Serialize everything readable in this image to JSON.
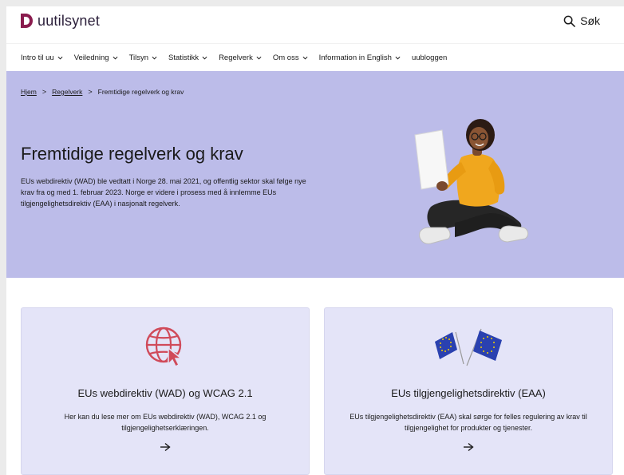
{
  "header": {
    "logo_text": "uutilsynet",
    "search_label": "Søk"
  },
  "nav": {
    "items": [
      {
        "label": "Intro til uu",
        "dropdown": true
      },
      {
        "label": "Veiledning",
        "dropdown": true
      },
      {
        "label": "Tilsyn",
        "dropdown": true
      },
      {
        "label": "Statistikk",
        "dropdown": true
      },
      {
        "label": "Regelverk",
        "dropdown": true
      },
      {
        "label": "Om oss",
        "dropdown": true
      },
      {
        "label": "Information in English",
        "dropdown": true
      },
      {
        "label": "uubloggen",
        "dropdown": false
      }
    ]
  },
  "breadcrumb": {
    "home": "Hjem",
    "parent": "Regelverk",
    "current": "Fremtidige regelverk og krav",
    "separator": ">"
  },
  "hero": {
    "title": "Fremtidige regelverk og krav",
    "text": "EUs webdirektiv (WAD) ble vedtatt i Norge 28. mai 2021, og offentlig sektor skal følge nye krav fra og med 1. februar 2023. Norge er videre i prosess med å innlemme EUs tilgjengelighetsdirektiv (EAA) i nasjonalt regelverk.",
    "illustration": "person-holding-document-illustration"
  },
  "cards": [
    {
      "title": "EUs webdirektiv (WAD) og WCAG 2.1",
      "text": "Her kan du lese mer om EUs webdirektiv (WAD), WCAG 2.1 og tilgjengelighetserklæringen.",
      "icon": "globe-cursor-icon",
      "arrow": "→"
    },
    {
      "title": "EUs tilgjengelighetsdirektiv (EAA)",
      "text": "EUs tilgjengelighetsdirektiv (EAA) skal sørge for felles regulering av krav til tilgjengelighet for produkter og tjenester.",
      "icon": "eu-flags-icon",
      "arrow": "→"
    }
  ],
  "colors": {
    "brand": "#8a1c4e",
    "hero_bg": "#bcbce9",
    "card_bg": "#e4e4f8",
    "icon_red": "#d04a5a",
    "eu_blue": "#2a41b0",
    "eu_gold": "#f4d000"
  }
}
